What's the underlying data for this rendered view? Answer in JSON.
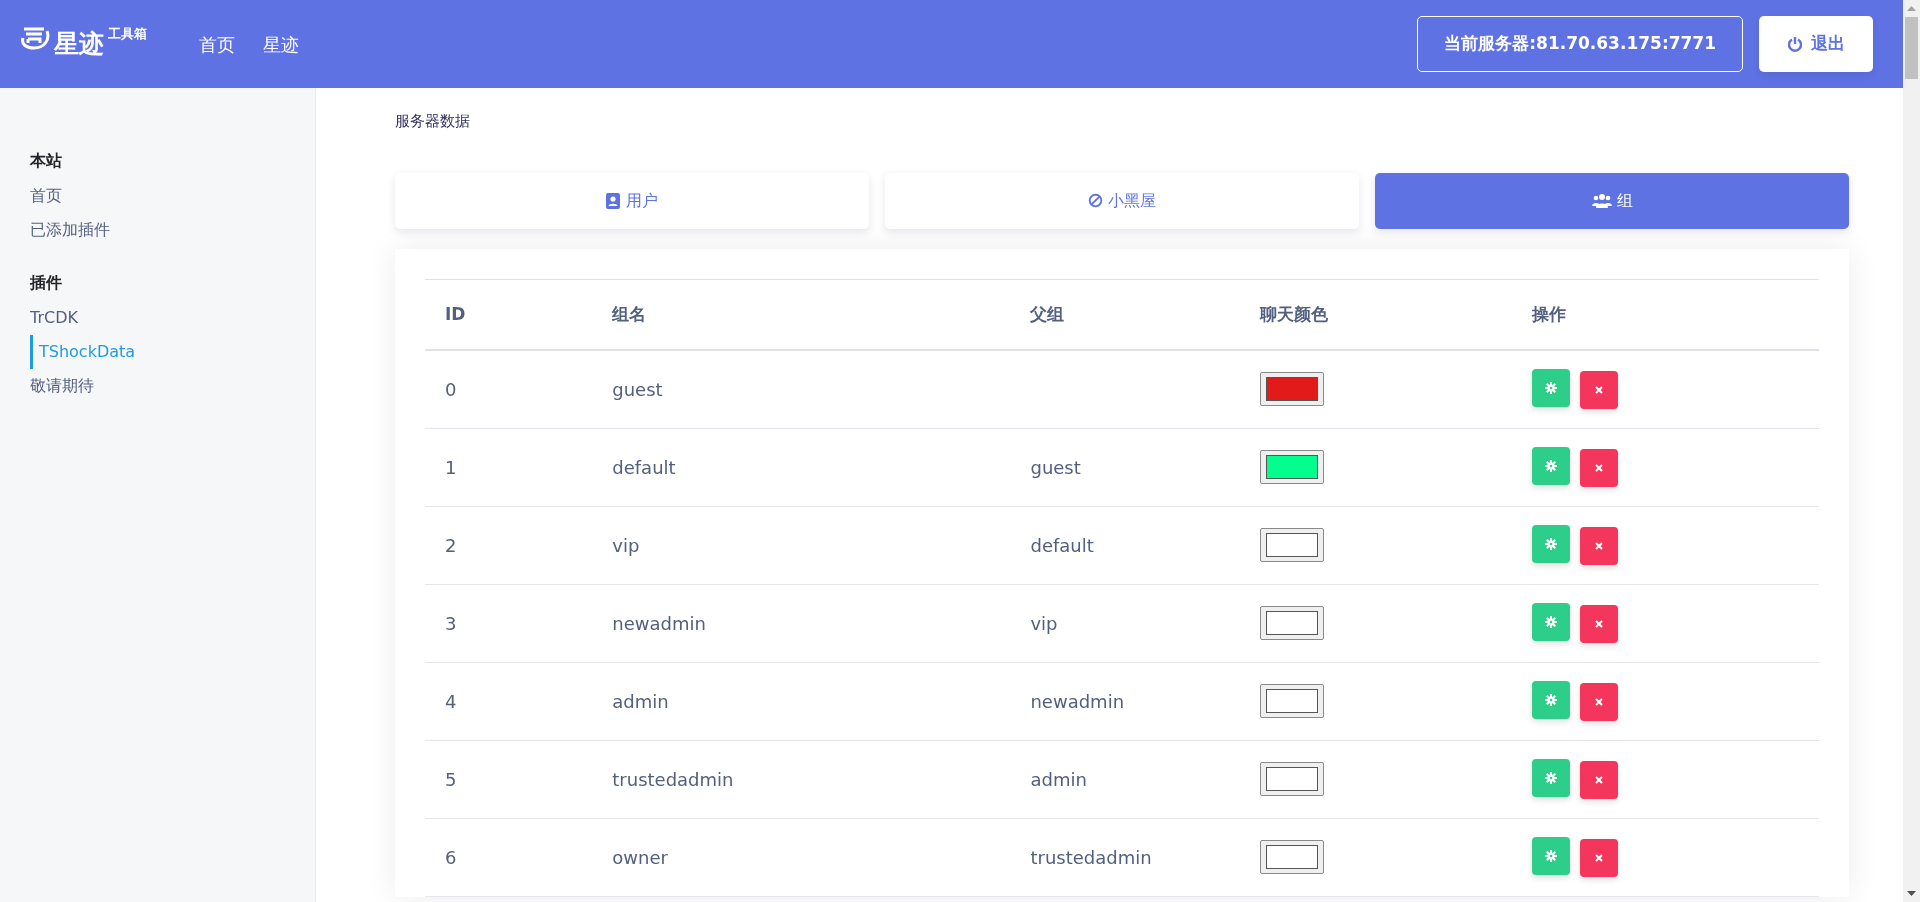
{
  "navbar": {
    "brand": "星迹",
    "brand_sup": "工具箱",
    "links": [
      {
        "label": "首页"
      },
      {
        "label": "星迹"
      }
    ],
    "server": "当前服务器:81.70.63.175:7771",
    "logout": "退出"
  },
  "sidebar": {
    "sections": [
      {
        "title": "本站",
        "items": [
          {
            "label": "首页",
            "selected": false
          },
          {
            "label": "已添加插件",
            "selected": false
          }
        ]
      },
      {
        "title": "插件",
        "items": [
          {
            "label": "TrCDK",
            "selected": false
          },
          {
            "label": "TShockData",
            "selected": true
          },
          {
            "label": "敬请期待",
            "selected": false
          }
        ]
      }
    ]
  },
  "page_title": "服务器数据",
  "tabs": [
    {
      "kind": "user",
      "label": "用户",
      "selected": false
    },
    {
      "kind": "ban",
      "label": "小黑屋",
      "selected": false
    },
    {
      "kind": "group",
      "label": "组",
      "selected": true
    }
  ],
  "table": {
    "columns": [
      "ID",
      "组名",
      "父组",
      "聊天颜色",
      "操作"
    ],
    "rows": [
      {
        "id": "0",
        "name": "guest",
        "parent": "",
        "color": "#e31a1a"
      },
      {
        "id": "1",
        "name": "default",
        "parent": "guest",
        "color": "#00ff8c"
      },
      {
        "id": "2",
        "name": "vip",
        "parent": "default",
        "color": "#ffffff"
      },
      {
        "id": "3",
        "name": "newadmin",
        "parent": "vip",
        "color": "#ffffff"
      },
      {
        "id": "4",
        "name": "admin",
        "parent": "newadmin",
        "color": "#ffffff"
      },
      {
        "id": "5",
        "name": "trustedadmin",
        "parent": "admin",
        "color": "#ffffff"
      },
      {
        "id": "6",
        "name": "owner",
        "parent": "trustedadmin",
        "color": "#ffffff"
      }
    ]
  }
}
